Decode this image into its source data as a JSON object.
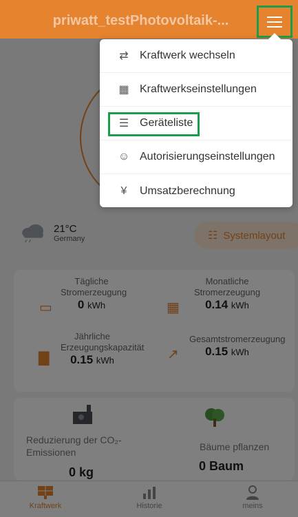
{
  "header": {
    "title": "priwatt_testPhotovoltaik-..."
  },
  "menu": {
    "items": [
      {
        "label": "Kraftwerk wechseln",
        "icon": "switch-arrows-icon"
      },
      {
        "label": "Kraftwerkseinstellungen",
        "icon": "solar-panel-icon"
      },
      {
        "label": "Geräteliste",
        "icon": "checklist-icon"
      },
      {
        "label": "Autorisierungseinstellungen",
        "icon": "user-auth-icon"
      },
      {
        "label": "Umsatzberechnung",
        "icon": "money-bag-icon"
      }
    ]
  },
  "weather": {
    "temp": "21°C",
    "location": "Germany"
  },
  "system_layout": {
    "label": "Systemlayout"
  },
  "stats": {
    "daily": {
      "label": "Tägliche Stromerzeugung",
      "value": "0",
      "unit": "kWh"
    },
    "monthly": {
      "label": "Monatliche Stromerzeugung",
      "value": "0.14",
      "unit": "kWh"
    },
    "yearly": {
      "label": "Jährliche Erzeugungskapazität",
      "value": "0.15",
      "unit": "kWh"
    },
    "total": {
      "label": "Gesamtstromerzeugung",
      "value": "0.15",
      "unit": "kWh"
    }
  },
  "impact": {
    "co2_label": "Reduzierung der CO₂-Emissionen",
    "co2_value": "0 kg",
    "trees_label": "Bäume pflanzen",
    "trees_value": "0 Baum"
  },
  "nav": {
    "items": [
      {
        "label": "Kraftwerk",
        "active": true
      },
      {
        "label": "Historie",
        "active": false
      },
      {
        "label": "meins",
        "active": false
      }
    ]
  },
  "colors": {
    "accent": "#e5832f",
    "highlight": "#1a9e4b"
  }
}
